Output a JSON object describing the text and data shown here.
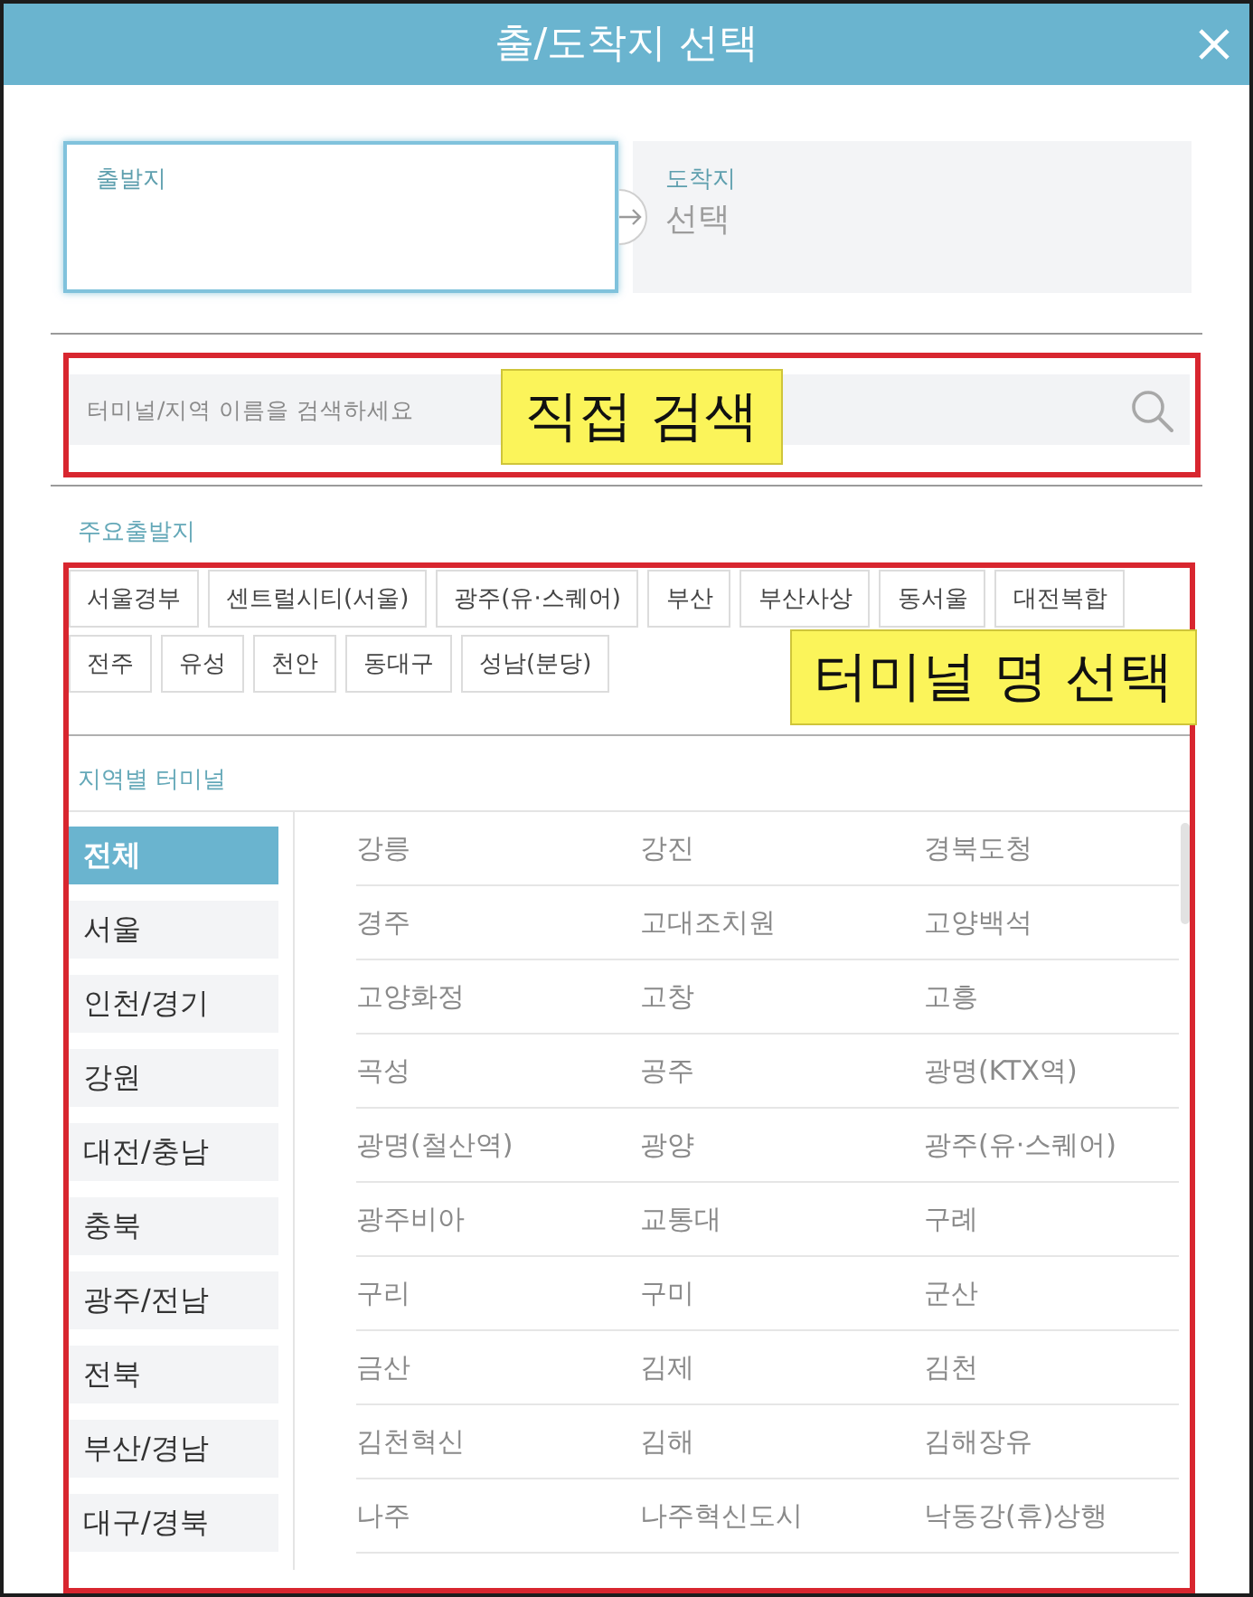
{
  "window": {
    "title": "출/도착지 선택"
  },
  "route": {
    "origin": {
      "label": "출발지",
      "selected": true
    },
    "destination": {
      "label": "도착지",
      "value": "선택",
      "selected": false
    }
  },
  "search": {
    "placeholder": "터미널/지역 이름을 검색하세요",
    "highlighted": true,
    "callout": "직접 검색"
  },
  "major_terminals": {
    "title": "주요출발지",
    "items": [
      "서울경부",
      "센트럴시티(서울)",
      "광주(유·스퀘어)",
      "부산",
      "부산사상",
      "동서울",
      "대전복합",
      "전주",
      "유성",
      "천안",
      "동대구",
      "성남(분당)"
    ]
  },
  "terminal_picker": {
    "highlighted": true,
    "callout": "터미널 명 선택"
  },
  "regional_terminals": {
    "title": "지역별 터미널",
    "regions": [
      {
        "label": "전체",
        "selected": true
      },
      {
        "label": "서울",
        "selected": false
      },
      {
        "label": "인천/경기",
        "selected": false
      },
      {
        "label": "강원",
        "selected": false
      },
      {
        "label": "대전/충남",
        "selected": false
      },
      {
        "label": "충북",
        "selected": false
      },
      {
        "label": "광주/전남",
        "selected": false
      },
      {
        "label": "전북",
        "selected": false
      },
      {
        "label": "부산/경남",
        "selected": false
      },
      {
        "label": "대구/경북",
        "selected": false
      }
    ],
    "terminals": [
      "강릉",
      "강진",
      "경북도청",
      "경주",
      "고대조치원",
      "고양백석",
      "고양화정",
      "고창",
      "고흥",
      "곡성",
      "공주",
      "광명(KTX역)",
      "광명(철산역)",
      "광양",
      "광주(유·스퀘어)",
      "광주비아",
      "교통대",
      "구례",
      "구리",
      "구미",
      "군산",
      "금산",
      "김제",
      "김천",
      "김천혁신",
      "김해",
      "김해장유",
      "나주",
      "나주혁신도시",
      "낙동강(휴)상행"
    ]
  }
}
